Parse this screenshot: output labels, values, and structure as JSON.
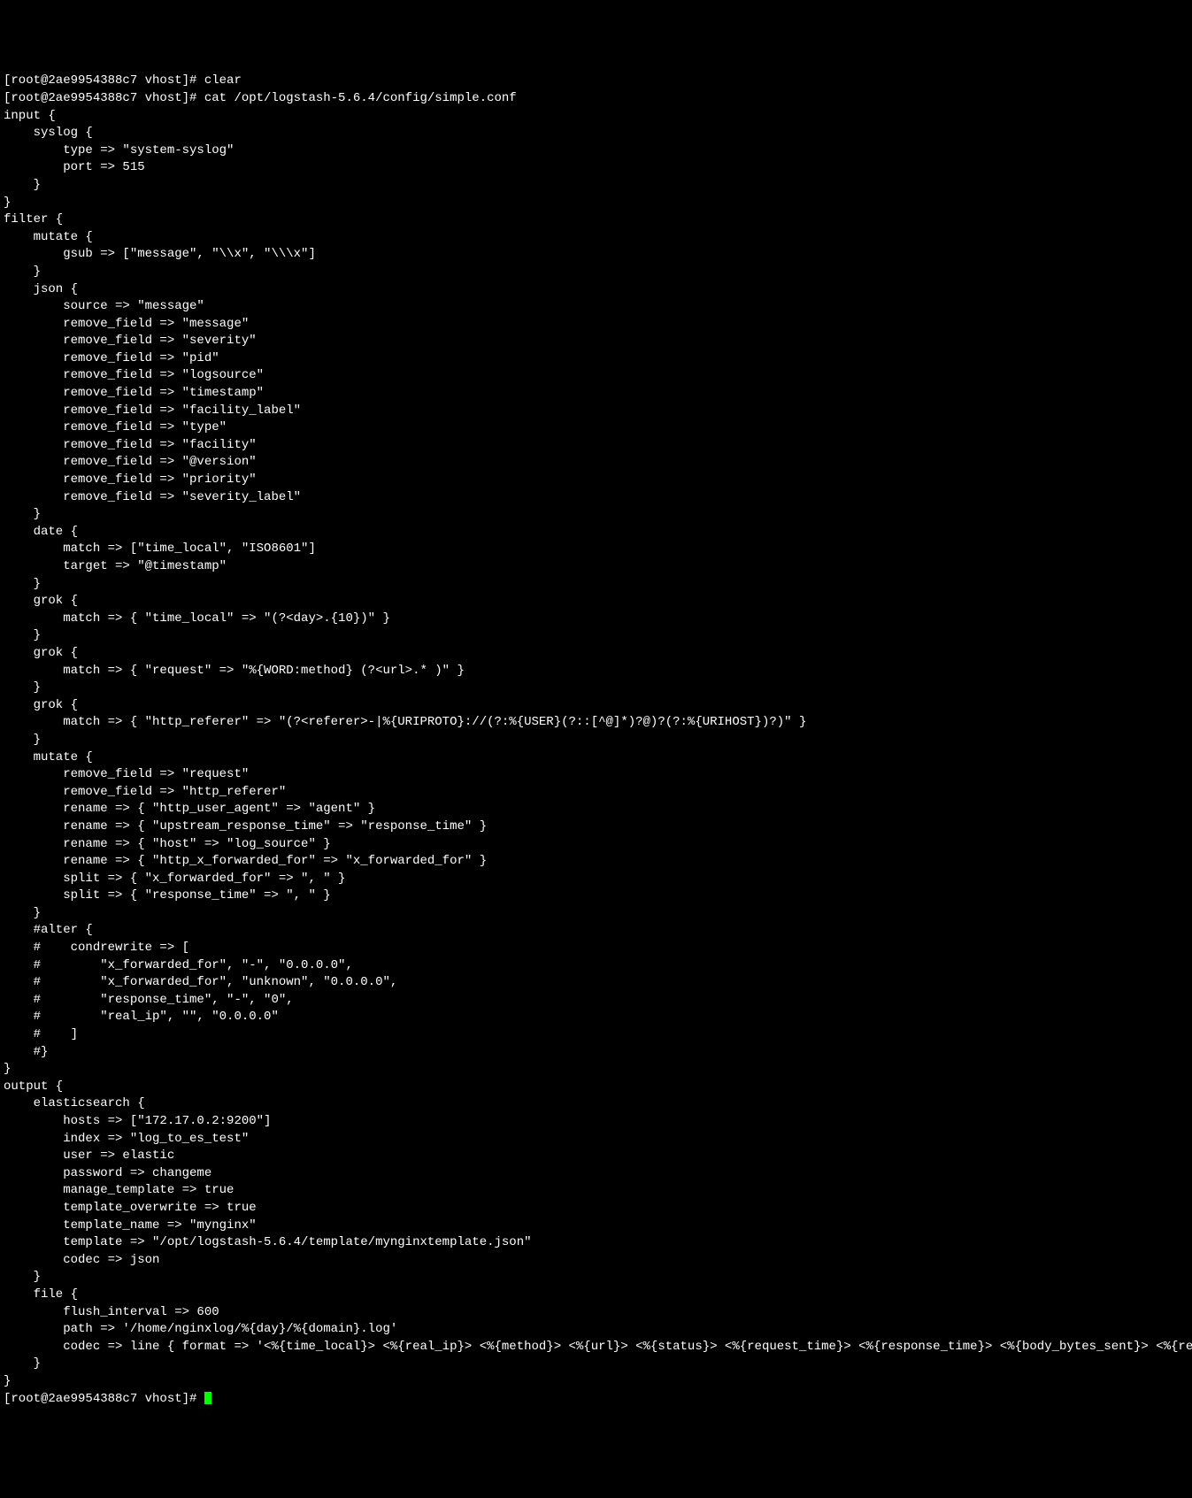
{
  "terminal": {
    "lines": [
      "[root@2ae9954388c7 vhost]# clear",
      "[root@2ae9954388c7 vhost]# cat /opt/logstash-5.6.4/config/simple.conf",
      "input {",
      "    syslog {",
      "        type => \"system-syslog\"",
      "        port => 515",
      "    }",
      "}",
      "",
      "filter {",
      "    mutate {",
      "        gsub => [\"message\", \"\\\\x\", \"\\\\\\x\"]",
      "    }",
      "    json {",
      "        source => \"message\"",
      "        remove_field => \"message\"",
      "        remove_field => \"severity\"",
      "        remove_field => \"pid\"",
      "        remove_field => \"logsource\"",
      "        remove_field => \"timestamp\"",
      "        remove_field => \"facility_label\"",
      "        remove_field => \"type\"",
      "        remove_field => \"facility\"",
      "        remove_field => \"@version\"",
      "        remove_field => \"priority\"",
      "        remove_field => \"severity_label\"",
      "    }",
      "    date {",
      "        match => [\"time_local\", \"ISO8601\"]",
      "        target => \"@timestamp\"",
      "    }",
      "    grok {",
      "        match => { \"time_local\" => \"(?<day>.{10})\" }",
      "    }",
      "    grok {",
      "        match => { \"request\" => \"%{WORD:method} (?<url>.* )\" }",
      "    }",
      "    grok {",
      "        match => { \"http_referer\" => \"(?<referer>-|%{URIPROTO}://(?:%{USER}(?::[^@]*)?@)?(?:%{URIHOST})?)\" }",
      "    }",
      "    mutate {",
      "        remove_field => \"request\"",
      "        remove_field => \"http_referer\"",
      "        rename => { \"http_user_agent\" => \"agent\" }",
      "        rename => { \"upstream_response_time\" => \"response_time\" }",
      "        rename => { \"host\" => \"log_source\" }",
      "        rename => { \"http_x_forwarded_for\" => \"x_forwarded_for\" }",
      "        split => { \"x_forwarded_for\" => \", \" }",
      "        split => { \"response_time\" => \", \" }",
      "    }",
      "    #alter {",
      "    #    condrewrite => [",
      "    #        \"x_forwarded_for\", \"-\", \"0.0.0.0\",",
      "    #        \"x_forwarded_for\", \"unknown\", \"0.0.0.0\",",
      "    #        \"response_time\", \"-\", \"0\",",
      "    #        \"real_ip\", \"\", \"0.0.0.0\"",
      "    #    ]",
      "    #}",
      "}",
      "",
      "output {",
      "    elasticsearch {",
      "        hosts => [\"172.17.0.2:9200\"]",
      "        index => \"log_to_es_test\"",
      "        user => elastic",
      "        password => changeme",
      "        manage_template => true",
      "        template_overwrite => true",
      "        template_name => \"mynginx\"",
      "        template => \"/opt/logstash-5.6.4/template/mynginxtemplate.json\"",
      "        codec => json",
      "    }",
      "    file {",
      "        flush_interval => 600",
      "        path => '/home/nginxlog/%{day}/%{domain}.log'",
      "        codec => line { format => '<%{time_local}> <%{real_ip}> <%{method}> <%{url}> <%{status}> <%{request_time}> <%{response_time}> <%{body_bytes_sent}> <%{request_body}> <%{referer}> <%{x_forwarded_for}> <%{log_source}> <%{agent}>'}",
      "    }",
      "}"
    ],
    "prompt": "[root@2ae9954388c7 vhost]# "
  }
}
